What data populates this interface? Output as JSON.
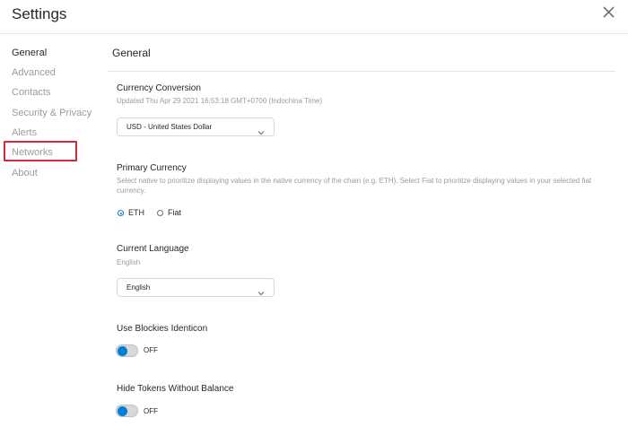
{
  "header": {
    "title": "Settings",
    "close_icon": "close-icon"
  },
  "sidebar": {
    "items": [
      {
        "label": "General",
        "active": true
      },
      {
        "label": "Advanced",
        "active": false
      },
      {
        "label": "Contacts",
        "active": false
      },
      {
        "label": "Security & Privacy",
        "active": false
      },
      {
        "label": "Alerts",
        "active": false
      },
      {
        "label": "Networks",
        "active": false,
        "highlighted": true
      },
      {
        "label": "About",
        "active": false
      }
    ]
  },
  "main": {
    "title": "General",
    "currency_conversion": {
      "label": "Currency Conversion",
      "updated": "Updated Thu Apr 29 2021 16:53:18 GMT+0700 (Indochina Time)",
      "selected": "USD - United States Dollar"
    },
    "primary_currency": {
      "label": "Primary Currency",
      "description": "Select native to prioritize displaying values in the native currency of the chain (e.g. ETH). Select Fiat to prioritize displaying values in your selected fiat currency.",
      "options": [
        {
          "label": "ETH",
          "selected": true
        },
        {
          "label": "Fiat",
          "selected": false
        }
      ]
    },
    "current_language": {
      "label": "Current Language",
      "current": "English",
      "selected": "English"
    },
    "blockies": {
      "label": "Use Blockies Identicon",
      "state": "OFF"
    },
    "hide_tokens": {
      "label": "Hide Tokens Without Balance",
      "state": "OFF"
    }
  },
  "colors": {
    "accent": "#037dd6",
    "highlight_box": "#d3273e",
    "muted_text": "#9b9b9b"
  }
}
